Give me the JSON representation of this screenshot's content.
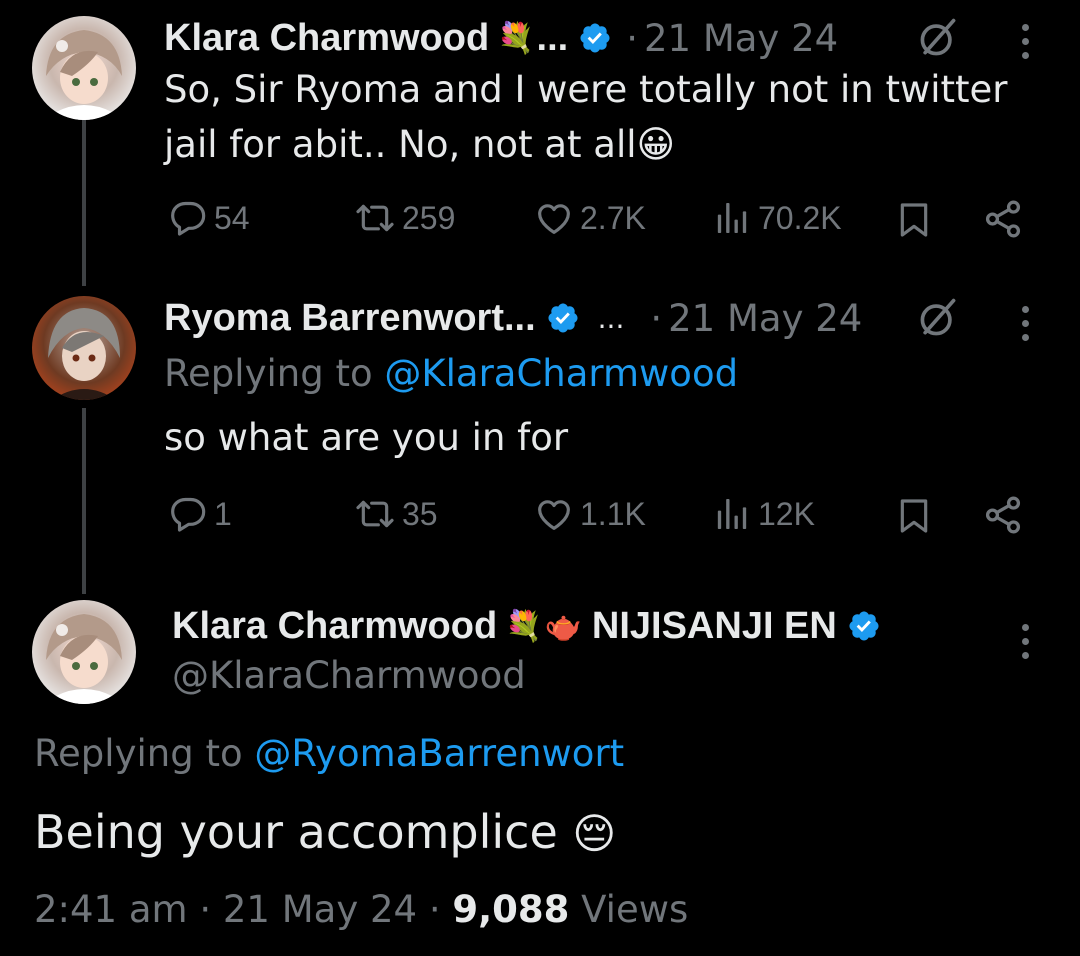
{
  "tweets": [
    {
      "display_name": "Klara Charmwood",
      "name_emoji": "💐",
      "name_truncation": "...",
      "separator": "·",
      "date": "21 May 24",
      "text_line1": "So, Sir Ryoma and I were totally not in twitter",
      "text_line2": "jail for abit.. No, not at all",
      "text_emoji": "😀",
      "replies": "54",
      "reposts": "259",
      "likes": "2.7K",
      "views": "70.2K"
    },
    {
      "display_name": "Ryoma Barrenwort...",
      "name_ellipsis": "...",
      "separator": "·",
      "date": "21 May 24",
      "replying_label": "Replying to",
      "replying_to": "@KlaraCharmwood",
      "text": "so what are you in for",
      "replies": "1",
      "reposts": "35",
      "likes": "1.1K",
      "views": "12K"
    }
  ],
  "main_tweet": {
    "display_name": "Klara Charmwood",
    "name_emoji_1": "💐",
    "name_emoji_2": "🫖",
    "affiliation": "NIJISANJI EN",
    "handle": "@KlaraCharmwood",
    "replying_label": "Replying to",
    "replying_to": "@RyomaBarrenwort",
    "text": "Being your accomplice",
    "text_emoji": "😔",
    "time": "2:41 am",
    "separator": "·",
    "date": "21 May 24",
    "views_count": "9,088",
    "views_label": "Views"
  },
  "colors": {
    "background": "#000000",
    "text_primary": "#e7e9ea",
    "text_secondary": "#71767b",
    "accent": "#1d9bf0"
  },
  "icons": [
    "reply-icon",
    "repost-icon",
    "like-icon",
    "views-icon",
    "bookmark-icon",
    "share-icon",
    "grok-icon",
    "more-icon",
    "verified-icon"
  ]
}
